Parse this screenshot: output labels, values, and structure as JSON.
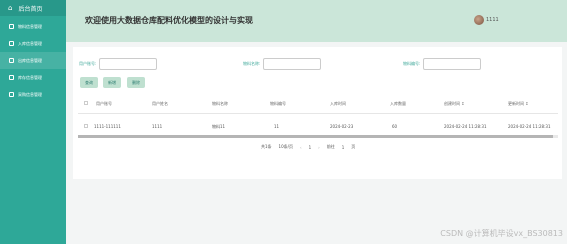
{
  "sidebar": {
    "home_label": "后台首页",
    "items": [
      {
        "label": "物料信息管理"
      },
      {
        "label": "入库信息管理"
      },
      {
        "label": "出库信息管理"
      },
      {
        "label": "库存信息管理"
      },
      {
        "label": "采购信息管理"
      }
    ]
  },
  "header": {
    "title": "欢迎使用大数据仓库配料优化模型的设计与实现",
    "username": "1111"
  },
  "filters": {
    "f1_label": "用户账号:",
    "f2_label": "物料名称:",
    "f3_label": "物料编号:"
  },
  "buttons": {
    "search": "查询",
    "add": "新增",
    "delete": "删除"
  },
  "table": {
    "headers": [
      "用户账号",
      "用户姓名",
      "物料名称",
      "物料编号",
      "入库时间",
      "入库数量",
      "创建时间 ↕",
      "更新时间 ↕"
    ],
    "rows": [
      [
        "1111-111111",
        "1111",
        "物料11",
        "11",
        "2024-02-23",
        "60",
        "2024-02-24 11:28:31",
        "2024-02-24 11:28:31"
      ]
    ],
    "scroll_fraction": 0.99
  },
  "pagination": {
    "total": "共1条",
    "page_size": "10条/页",
    "prev": "‹",
    "current": "1",
    "next": "›",
    "goto_label": "前往",
    "goto_value": "1",
    "page_suffix": "页"
  },
  "watermark": "CSDN @计算机毕设vx_BS30813",
  "colors": {
    "sidebar": "#2ea898",
    "header": "#cbe6d9",
    "accent": "#3fa89a"
  }
}
